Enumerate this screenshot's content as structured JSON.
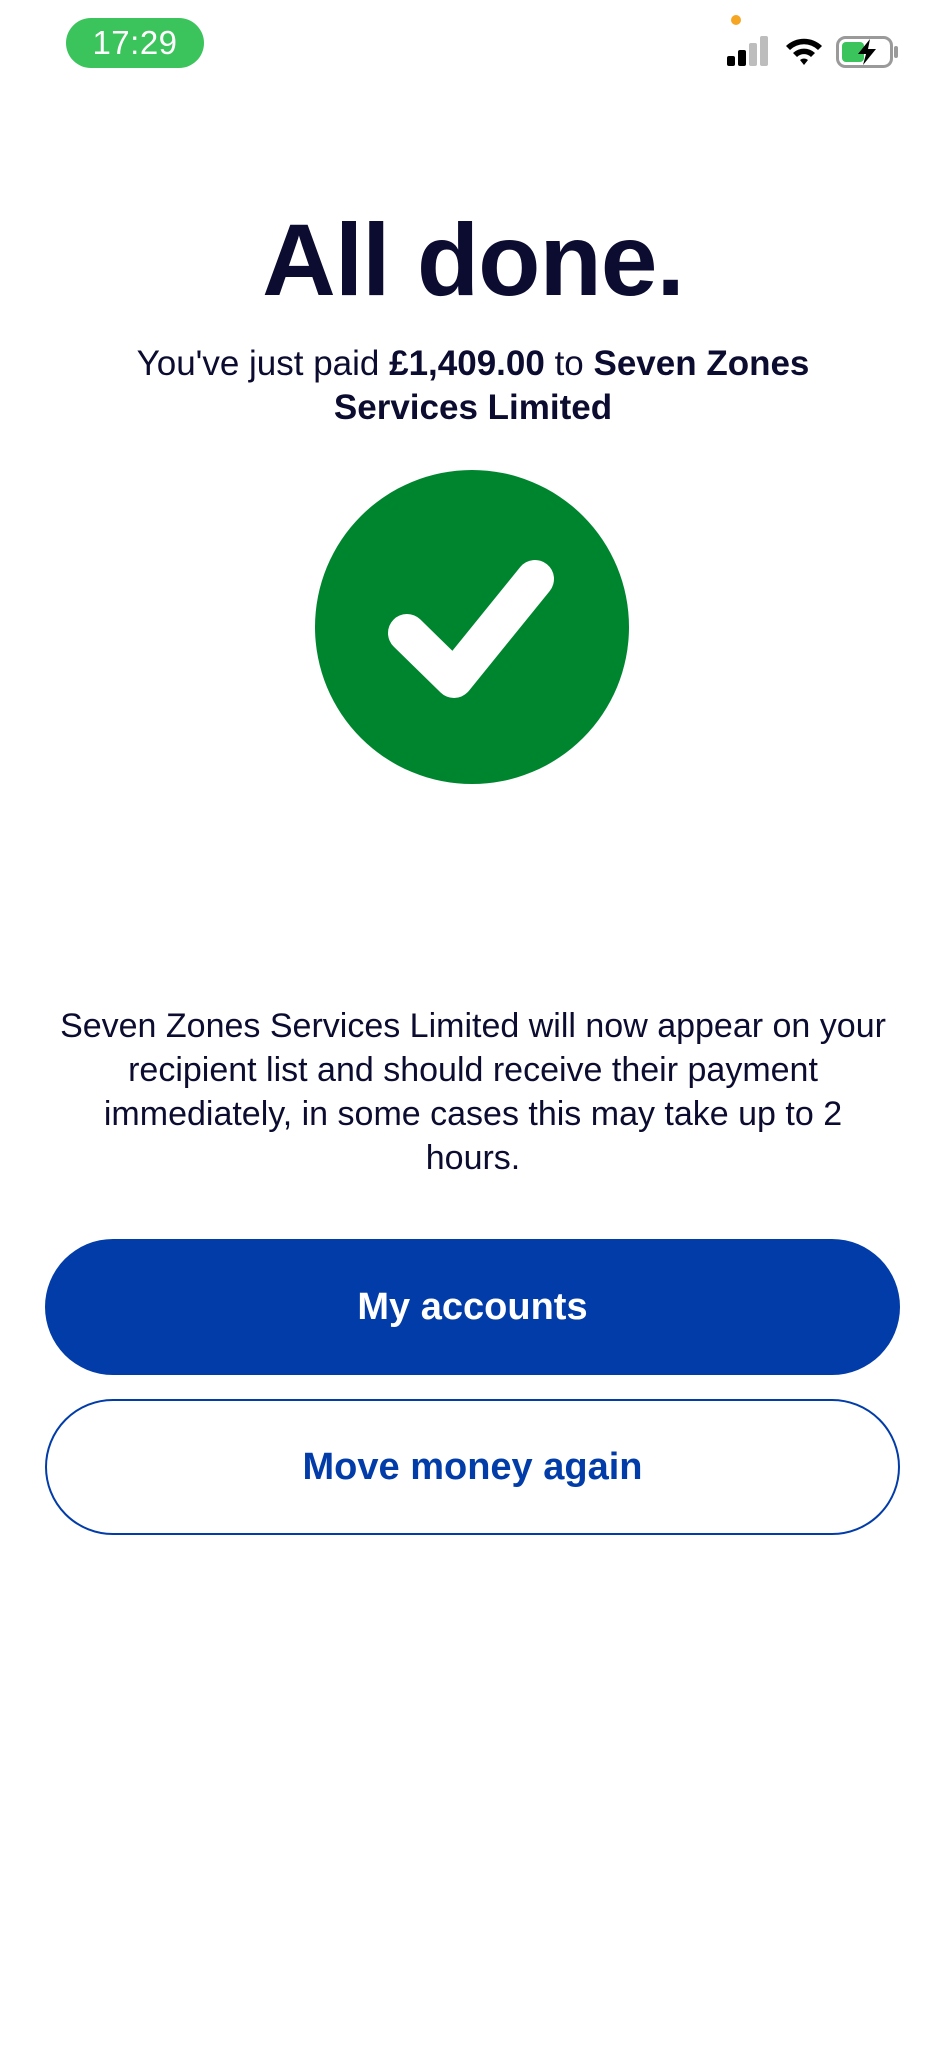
{
  "status_bar": {
    "time": "17:29"
  },
  "confirmation": {
    "title": "All done.",
    "subtitle_prefix": "You've just paid ",
    "amount": "£1,409.00",
    "subtitle_mid": " to ",
    "recipient": "Seven Zones Services Limited",
    "info": "Seven Zones Services Limited will now appear on your recipient list and should receive their payment immediately, in some cases this may take up to 2 hours."
  },
  "actions": {
    "primary_label": "My accounts",
    "secondary_label": "Move money again"
  },
  "icons": {
    "status": [
      "signal-icon",
      "wifi-icon",
      "battery-charging-icon"
    ],
    "success": "checkmark-circle-icon"
  },
  "colors": {
    "brand_blue": "#023ca9",
    "success_green": "#00852f",
    "time_pill_green": "#3ac45b",
    "text_dark": "#0c0c30"
  }
}
